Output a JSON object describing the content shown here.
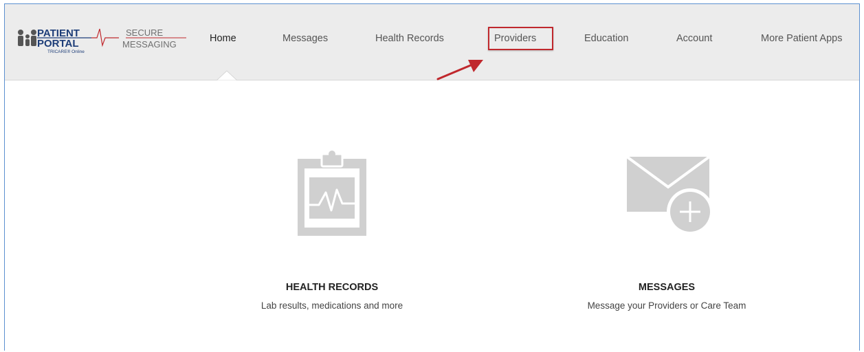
{
  "logo": {
    "line1": "PATIENT",
    "line2": "PORTAL",
    "subline": "TRICARE® Online",
    "secure": "SECURE",
    "messaging": "MESSAGING"
  },
  "nav": {
    "home": "Home",
    "messages": "Messages",
    "health_records": "Health Records",
    "providers": "Providers",
    "education": "Education",
    "account": "Account",
    "more": "More Patient Apps"
  },
  "cards": {
    "health_records": {
      "title": "HEALTH RECORDS",
      "subtitle": "Lab results, medications and more",
      "icon": "clipboard-heartbeat-icon"
    },
    "messages": {
      "title": "MESSAGES",
      "subtitle": "Message your Providers or Care Team",
      "icon": "envelope-plus-icon"
    }
  },
  "colors": {
    "navbar_bg": "#ececec",
    "highlight": "#c0282d",
    "icon_gray": "#d0d0d0",
    "frame_border": "#5b8fd0"
  }
}
